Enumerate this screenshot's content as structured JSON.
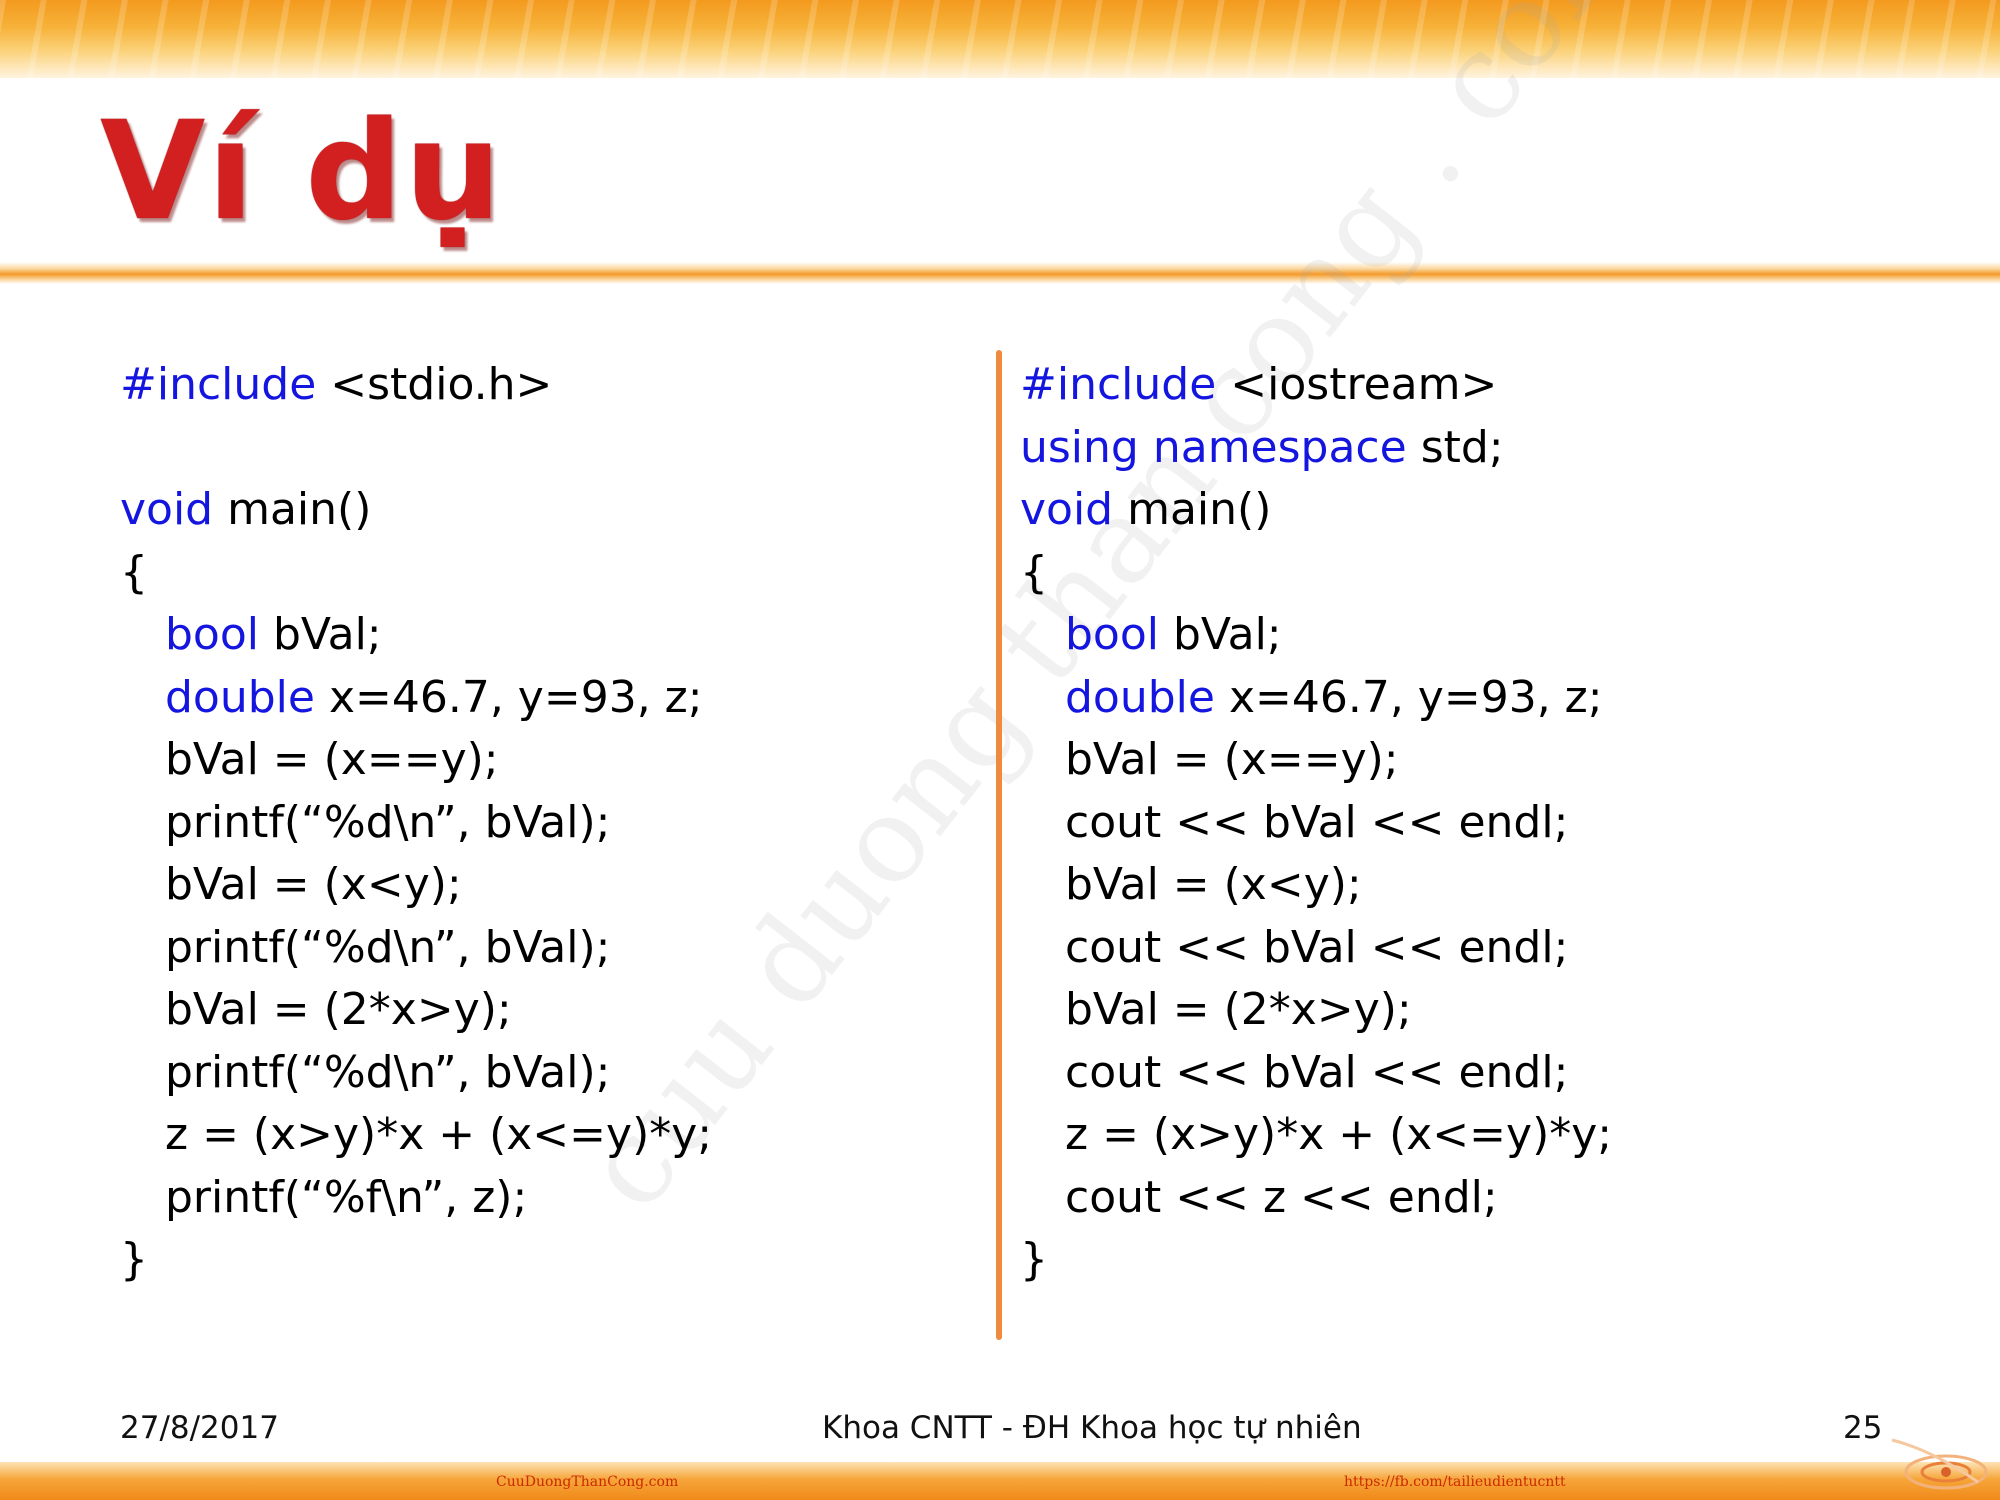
{
  "slide": {
    "title": "Ví dụ",
    "watermark": "cuu duong than cong . com"
  },
  "code_left": {
    "lines": [
      {
        "kw": "#include",
        "text": " <stdio.h>",
        "indent": false
      },
      {
        "kw": "",
        "text": "",
        "indent": false
      },
      {
        "kw": "void",
        "text": " main()",
        "indent": false
      },
      {
        "kw": "",
        "text": "{",
        "indent": false
      },
      {
        "kw": "bool",
        "text": " bVal;",
        "indent": true
      },
      {
        "kw": "double",
        "text": " x=46.7, y=93, z;",
        "indent": true
      },
      {
        "kw": "",
        "text": "bVal = (x==y);",
        "indent": true
      },
      {
        "kw": "",
        "text": "printf(“%d\\n”, bVal);",
        "indent": true
      },
      {
        "kw": "",
        "text": "bVal = (x<y);",
        "indent": true
      },
      {
        "kw": "",
        "text": "printf(“%d\\n”, bVal);",
        "indent": true
      },
      {
        "kw": "",
        "text": "bVal = (2*x>y);",
        "indent": true
      },
      {
        "kw": "",
        "text": "printf(“%d\\n”, bVal);",
        "indent": true
      },
      {
        "kw": "",
        "text": "z = (x>y)*x + (x<=y)*y;",
        "indent": true
      },
      {
        "kw": "",
        "text": "printf(“%f\\n”, z);",
        "indent": true
      },
      {
        "kw": "",
        "text": "}",
        "indent": false
      }
    ]
  },
  "code_right": {
    "lines": [
      {
        "kw": "#include",
        "text": " <iostream>",
        "indent": false
      },
      {
        "kw": "using namespace",
        "text": " std;",
        "indent": false
      },
      {
        "kw": "void",
        "text": " main()",
        "indent": false
      },
      {
        "kw": "",
        "text": "{",
        "indent": false
      },
      {
        "kw": "bool",
        "text": " bVal;",
        "indent": true
      },
      {
        "kw": "double",
        "text": " x=46.7, y=93, z;",
        "indent": true
      },
      {
        "kw": "",
        "text": "bVal = (x==y);",
        "indent": true
      },
      {
        "kw": "",
        "text": "cout << bVal << endl;",
        "indent": true
      },
      {
        "kw": "",
        "text": "bVal = (x<y);",
        "indent": true
      },
      {
        "kw": "",
        "text": "cout << bVal << endl;",
        "indent": true
      },
      {
        "kw": "",
        "text": "bVal = (2*x>y);",
        "indent": true
      },
      {
        "kw": "",
        "text": "cout << bVal << endl;",
        "indent": true
      },
      {
        "kw": "",
        "text": "z = (x>y)*x + (x<=y)*y;",
        "indent": true
      },
      {
        "kw": "",
        "text": "cout << z << endl;",
        "indent": true
      },
      {
        "kw": "",
        "text": "}",
        "indent": false
      }
    ]
  },
  "colors": {
    "keyword": "#1515e0",
    "title": "#d21f20",
    "accent": "#f08a3c"
  },
  "footer": {
    "date": "27/8/2017",
    "center": "Khoa CNTT - ĐH Khoa học tự nhiên",
    "page": "25",
    "link_left": "CuuDuongThanCong.com",
    "link_right": "https://fb.com/tailieudientucntt"
  }
}
